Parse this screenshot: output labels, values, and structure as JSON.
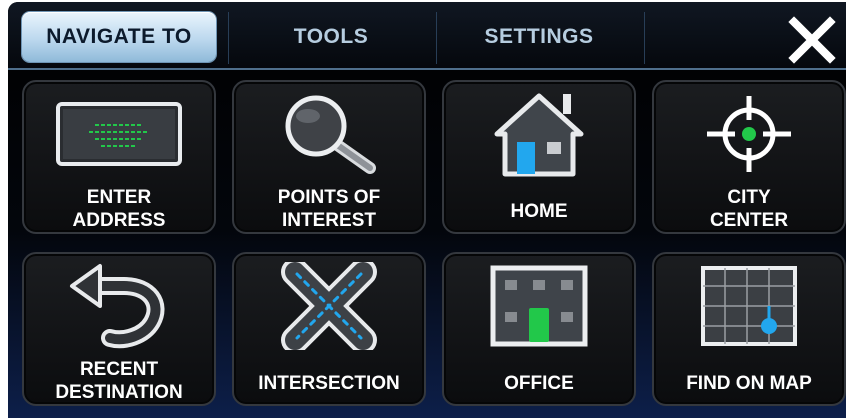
{
  "tabs": [
    {
      "label": "NAVIGATE TO",
      "active": true
    },
    {
      "label": "TOOLS",
      "active": false
    },
    {
      "label": "SETTINGS",
      "active": false
    }
  ],
  "close_icon": "close-icon",
  "tiles": [
    {
      "lines": [
        "ENTER",
        "ADDRESS"
      ],
      "icon": "keyboard-icon"
    },
    {
      "lines": [
        "POINTS OF",
        "INTEREST"
      ],
      "icon": "magnifier-icon"
    },
    {
      "lines": [
        "HOME"
      ],
      "icon": "house-icon"
    },
    {
      "lines": [
        "CITY",
        "CENTER"
      ],
      "icon": "crosshair-icon"
    },
    {
      "lines": [
        "RECENT",
        "DESTINATION"
      ],
      "icon": "back-arrow-icon"
    },
    {
      "lines": [
        "INTERSECTION"
      ],
      "icon": "intersection-icon"
    },
    {
      "lines": [
        "OFFICE"
      ],
      "icon": "office-icon"
    },
    {
      "lines": [
        "FIND ON MAP"
      ],
      "icon": "map-grid-icon"
    }
  ],
  "colors": {
    "accent_blue": "#22a7ee",
    "accent_green": "#22c84a",
    "tab_text": "#b6cde0"
  }
}
